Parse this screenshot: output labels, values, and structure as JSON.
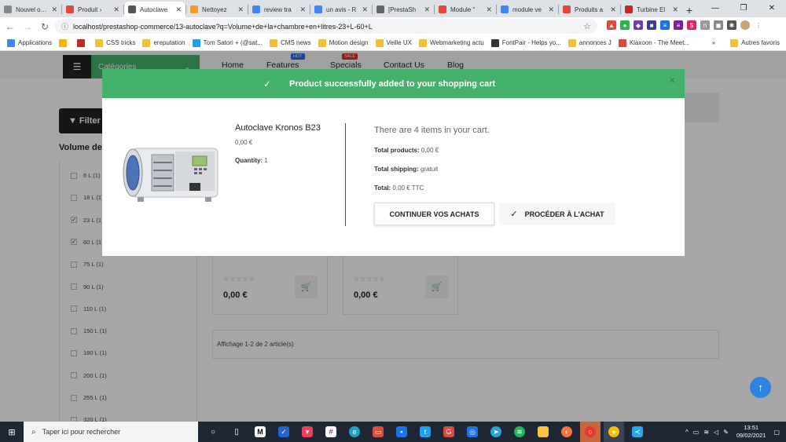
{
  "browser": {
    "tabs": [
      {
        "label": "Nouvel onglet",
        "color": "#888888"
      },
      {
        "label": "Produit ›",
        "color": "#e0473d"
      },
      {
        "label": "Autoclave",
        "color": "#555555",
        "active": true
      },
      {
        "label": "Nettoyez",
        "color": "#f19a2a"
      },
      {
        "label": "review tra",
        "color": "#4285f4"
      },
      {
        "label": "un avis - R",
        "color": "#4285f4"
      },
      {
        "label": "[PrestaSh",
        "color": "#666666"
      },
      {
        "label": "Module \"",
        "color": "#e0473d"
      },
      {
        "label": "module ve",
        "color": "#4285f4"
      },
      {
        "label": "Produits a",
        "color": "#e0473d"
      },
      {
        "label": "Turbine El",
        "color": "#c62828"
      }
    ],
    "new_tab": "+",
    "window_controls": [
      "—",
      "❐",
      "✕"
    ],
    "url": "localhost/prestashop-commerce/13-autoclave?q=Volume+de+la+chambre+en+litres-23+L-60+L",
    "bookmarks": [
      {
        "label": "Applications",
        "color": "#4285f4"
      },
      {
        "label": "",
        "color": "#f4b400"
      },
      {
        "label": "",
        "color": "#c62828"
      },
      {
        "label": "CSS tricks",
        "color": "#f2c037"
      },
      {
        "label": "ereputation",
        "color": "#f2c037"
      },
      {
        "label": "Tom Satori + (@sat...",
        "color": "#1da1f2"
      },
      {
        "label": "CMS news",
        "color": "#f2c037"
      },
      {
        "label": "Motion design",
        "color": "#f2c037"
      },
      {
        "label": "Veille UX",
        "color": "#f2c037"
      },
      {
        "label": "Webmarketing actu",
        "color": "#f2c037"
      },
      {
        "label": "FontPair - Helps yo...",
        "color": "#333333"
      },
      {
        "label": "annonces J",
        "color": "#f2c037"
      },
      {
        "label": "Klaxoon - The Meet...",
        "color": "#e0473d"
      }
    ],
    "bookmarks_more": "»",
    "other_favorites": "Autres favoris"
  },
  "site": {
    "nav": {
      "categories": "Catégories",
      "home": "Home",
      "features": "Features",
      "features_badge": "HOT",
      "specials": "Specials",
      "specials_badge": "SALE",
      "contact": "Contact Us",
      "blog": "Blog"
    },
    "filter_button": "Filter",
    "volume_title": "Volume de",
    "volume_items": [
      {
        "label": "6 L (1)",
        "checked": false
      },
      {
        "label": "18 L (1)",
        "checked": false
      },
      {
        "label": "23 L (1)",
        "checked": true
      },
      {
        "label": "60 L (1)",
        "checked": true
      },
      {
        "label": "75 L (1)",
        "checked": false
      },
      {
        "label": "90 L (1)",
        "checked": false
      },
      {
        "label": "110 L (1)",
        "checked": false
      },
      {
        "label": "150 L (1)",
        "checked": false
      },
      {
        "label": "180 L (1)",
        "checked": false
      },
      {
        "label": "200 L (1)",
        "checked": false
      },
      {
        "label": "255 L (1)",
        "checked": false
      },
      {
        "label": "320 L (1)",
        "checked": false
      }
    ],
    "products": [
      {
        "price": "0,00 €",
        "stars": "☆☆☆☆☆"
      },
      {
        "price": "0,00 €",
        "stars": "☆☆☆☆☆"
      }
    ],
    "pager_text": "Affichage 1-2 de 2 article(s)"
  },
  "modal": {
    "title": "Product successfully added to your shopping cart",
    "product_name": "Autoclave Kronos B23",
    "product_price": "0,00 €",
    "quantity_label": "Quantity:",
    "quantity_value": "1",
    "cart_count_text": "There are 4 items in your cart.",
    "total_products_label": "Total products:",
    "total_products_value": "0,00 €",
    "total_shipping_label": "Total shipping:",
    "total_shipping_value": "gratuit",
    "total_label": "Total:",
    "total_value": "0,00 € TTC",
    "continue_button": "CONTINUER VOS ACHATS",
    "checkout_button": "PROCÉDER À L'ACHAT",
    "accent_color": "#44b26b"
  },
  "taskbar": {
    "search_placeholder": "Taper ici pour rechercher",
    "time": "13:51",
    "date": "09/02/2021"
  }
}
